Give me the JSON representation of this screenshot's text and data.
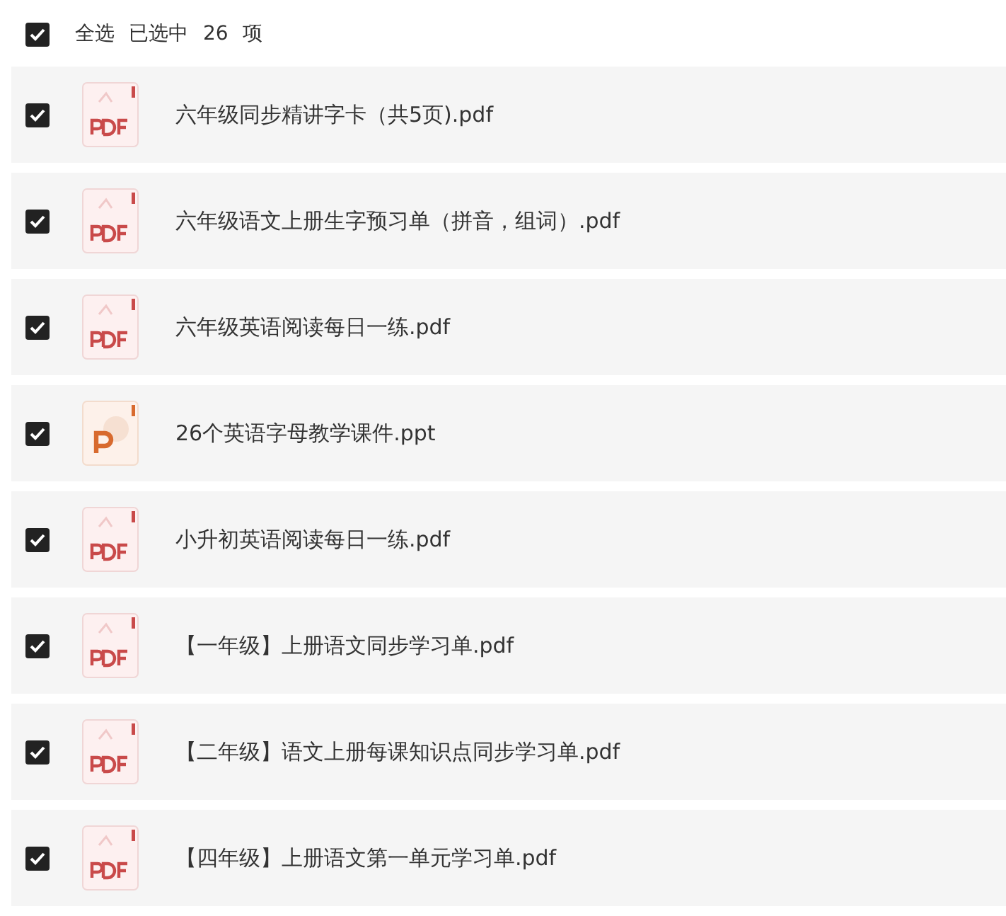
{
  "select_all": {
    "label": "全选",
    "checked": true,
    "summary": "已选中 26 项"
  },
  "files": [
    {
      "name": "六年级同步精讲字卡（共5页).pdf",
      "kind": "pdf",
      "checked": true
    },
    {
      "name": "六年级语文上册生字预习单（拼音，组词）.pdf",
      "kind": "pdf",
      "checked": true
    },
    {
      "name": "六年级英语阅读每日一练.pdf",
      "kind": "pdf",
      "checked": true
    },
    {
      "name": "26个英语字母教学课件.ppt",
      "kind": "ppt",
      "checked": true
    },
    {
      "name": "小升初英语阅读每日一练.pdf",
      "kind": "pdf",
      "checked": true
    },
    {
      "name": "【一年级】上册语文同步学习单.pdf",
      "kind": "pdf",
      "checked": true
    },
    {
      "name": "【二年级】语文上册每课知识点同步学习单.pdf",
      "kind": "pdf",
      "checked": true
    },
    {
      "name": "【四年级】上册语文第一单元学习单.pdf",
      "kind": "pdf",
      "checked": true
    }
  ]
}
